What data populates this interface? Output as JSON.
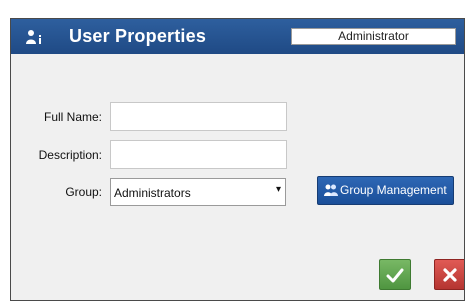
{
  "dialog": {
    "title": "User Properties",
    "current_user": "Administrator",
    "title_icon": "user-info-icon"
  },
  "form": {
    "full_name_label": "Full Name:",
    "full_name_value": "",
    "description_label": "Description:",
    "description_value": "",
    "group_label": "Group:",
    "group_selected": "Administrators"
  },
  "buttons": {
    "group_management_label": "Group Management",
    "group_management_icon": "users-icon",
    "ok_icon": "checkmark-icon",
    "cancel_icon": "close-icon"
  },
  "colors": {
    "titlebar": "#1f4a85",
    "ok_button": "#4f9540",
    "cancel_button": "#b53531",
    "group_button": "#1a4f99"
  }
}
